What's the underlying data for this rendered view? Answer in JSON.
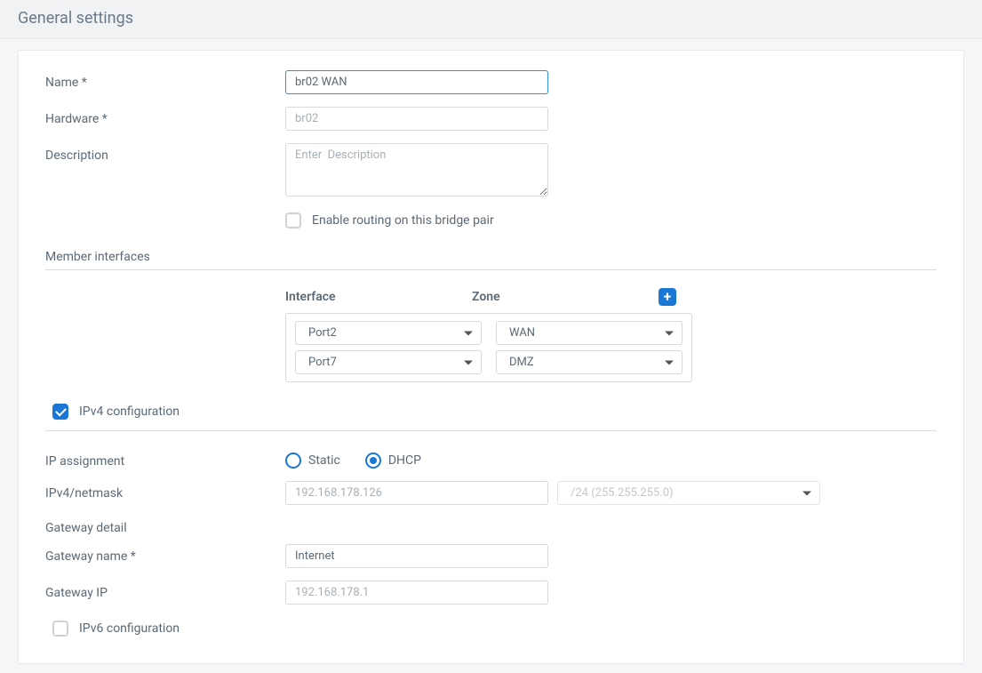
{
  "title": "General settings",
  "fields": {
    "name": {
      "label": "Name *",
      "value": "br02 WAN"
    },
    "hardware": {
      "label": "Hardware *",
      "value": "br02"
    },
    "description": {
      "label": "Description",
      "placeholder": "Enter  Description",
      "value": ""
    },
    "enable_routing": {
      "label": "Enable routing on this bridge pair",
      "checked": false
    }
  },
  "member_section": {
    "title": "Member interfaces",
    "headers": {
      "interface": "Interface",
      "zone": "Zone"
    },
    "rows": [
      {
        "interface": "Port2",
        "zone": "WAN"
      },
      {
        "interface": "Port7",
        "zone": "DMZ"
      }
    ]
  },
  "ipv4": {
    "section_label": "IPv4 configuration",
    "checked": true,
    "ip_assignment": {
      "label": "IP assignment",
      "options": {
        "static": "Static",
        "dhcp": "DHCP"
      },
      "selected": "dhcp"
    },
    "netmask": {
      "label": "IPv4/netmask",
      "ip": "192.168.178.126",
      "mask": "/24 (255.255.255.0)"
    },
    "gateway_heading": "Gateway detail",
    "gateway_name": {
      "label": "Gateway name  *",
      "value": "Internet"
    },
    "gateway_ip": {
      "label": "Gateway IP",
      "value": "192.168.178.1"
    }
  },
  "ipv6": {
    "section_label": "IPv6 configuration",
    "checked": false
  }
}
